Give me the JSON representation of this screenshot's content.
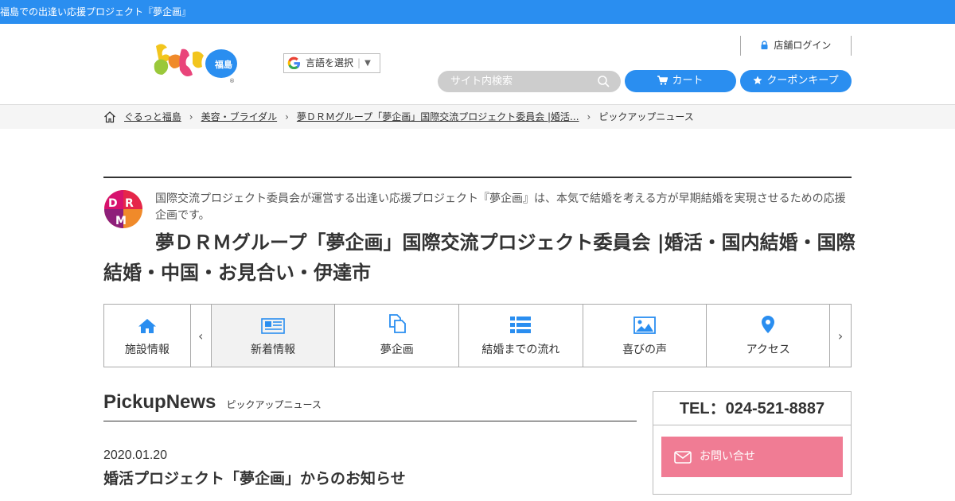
{
  "topbar": {
    "text": "福島での出逢い応援プロジェクト『夢企画』"
  },
  "header": {
    "logo_text": "福島",
    "language_label": "言語を選択",
    "language_arrow": "▼",
    "login_label": "店舗ログイン",
    "search_placeholder": "サイト内検索",
    "cart_label": "カート",
    "coupon_label": "クーポンキープ"
  },
  "breadcrumb": [
    {
      "label": "ぐるっと福島"
    },
    {
      "label": "美容・ブライダル"
    },
    {
      "label": "夢ＤＲＭグループ「夢企画」国際交流プロジェクト委員会 |婚活..."
    },
    {
      "label": "ピックアップニュース"
    }
  ],
  "shop": {
    "description": "国際交流プロジェクト委員会が運営する出逢い応援プロジェクト『夢企画』は、本気で結婚を考える方が早期結婚を実現させるための応援企画です。",
    "title": "夢ＤＲＭグループ「夢企画」国際交流プロジェクト委員会 |婚活・国内結婚・国際結婚・中国・お見合い・伊達市"
  },
  "nav": {
    "items": [
      {
        "label": "施設情報",
        "icon": "home-icon"
      },
      {
        "label": "新着情報",
        "icon": "newspaper-icon"
      },
      {
        "label": "夢企画",
        "icon": "documents-icon"
      },
      {
        "label": "結婚までの流れ",
        "icon": "list-icon"
      },
      {
        "label": "喜びの声",
        "icon": "image-icon"
      },
      {
        "label": "アクセス",
        "icon": "map-pin-icon"
      }
    ],
    "prev": "‹",
    "next": "›"
  },
  "pickup": {
    "heading_en": "PickupNews",
    "heading_jp": "ピックアップニュース"
  },
  "news": {
    "date": "2020.01.20",
    "title": "婚活プロジェクト「夢企画」からのお知らせ"
  },
  "sidebar": {
    "tel": "TEL：024-521-8887",
    "contact_label": "お問い合せ"
  },
  "colors": {
    "accent": "#2a8ef0",
    "contact": "#f07c94",
    "search_bg": "#cdcdcd"
  }
}
